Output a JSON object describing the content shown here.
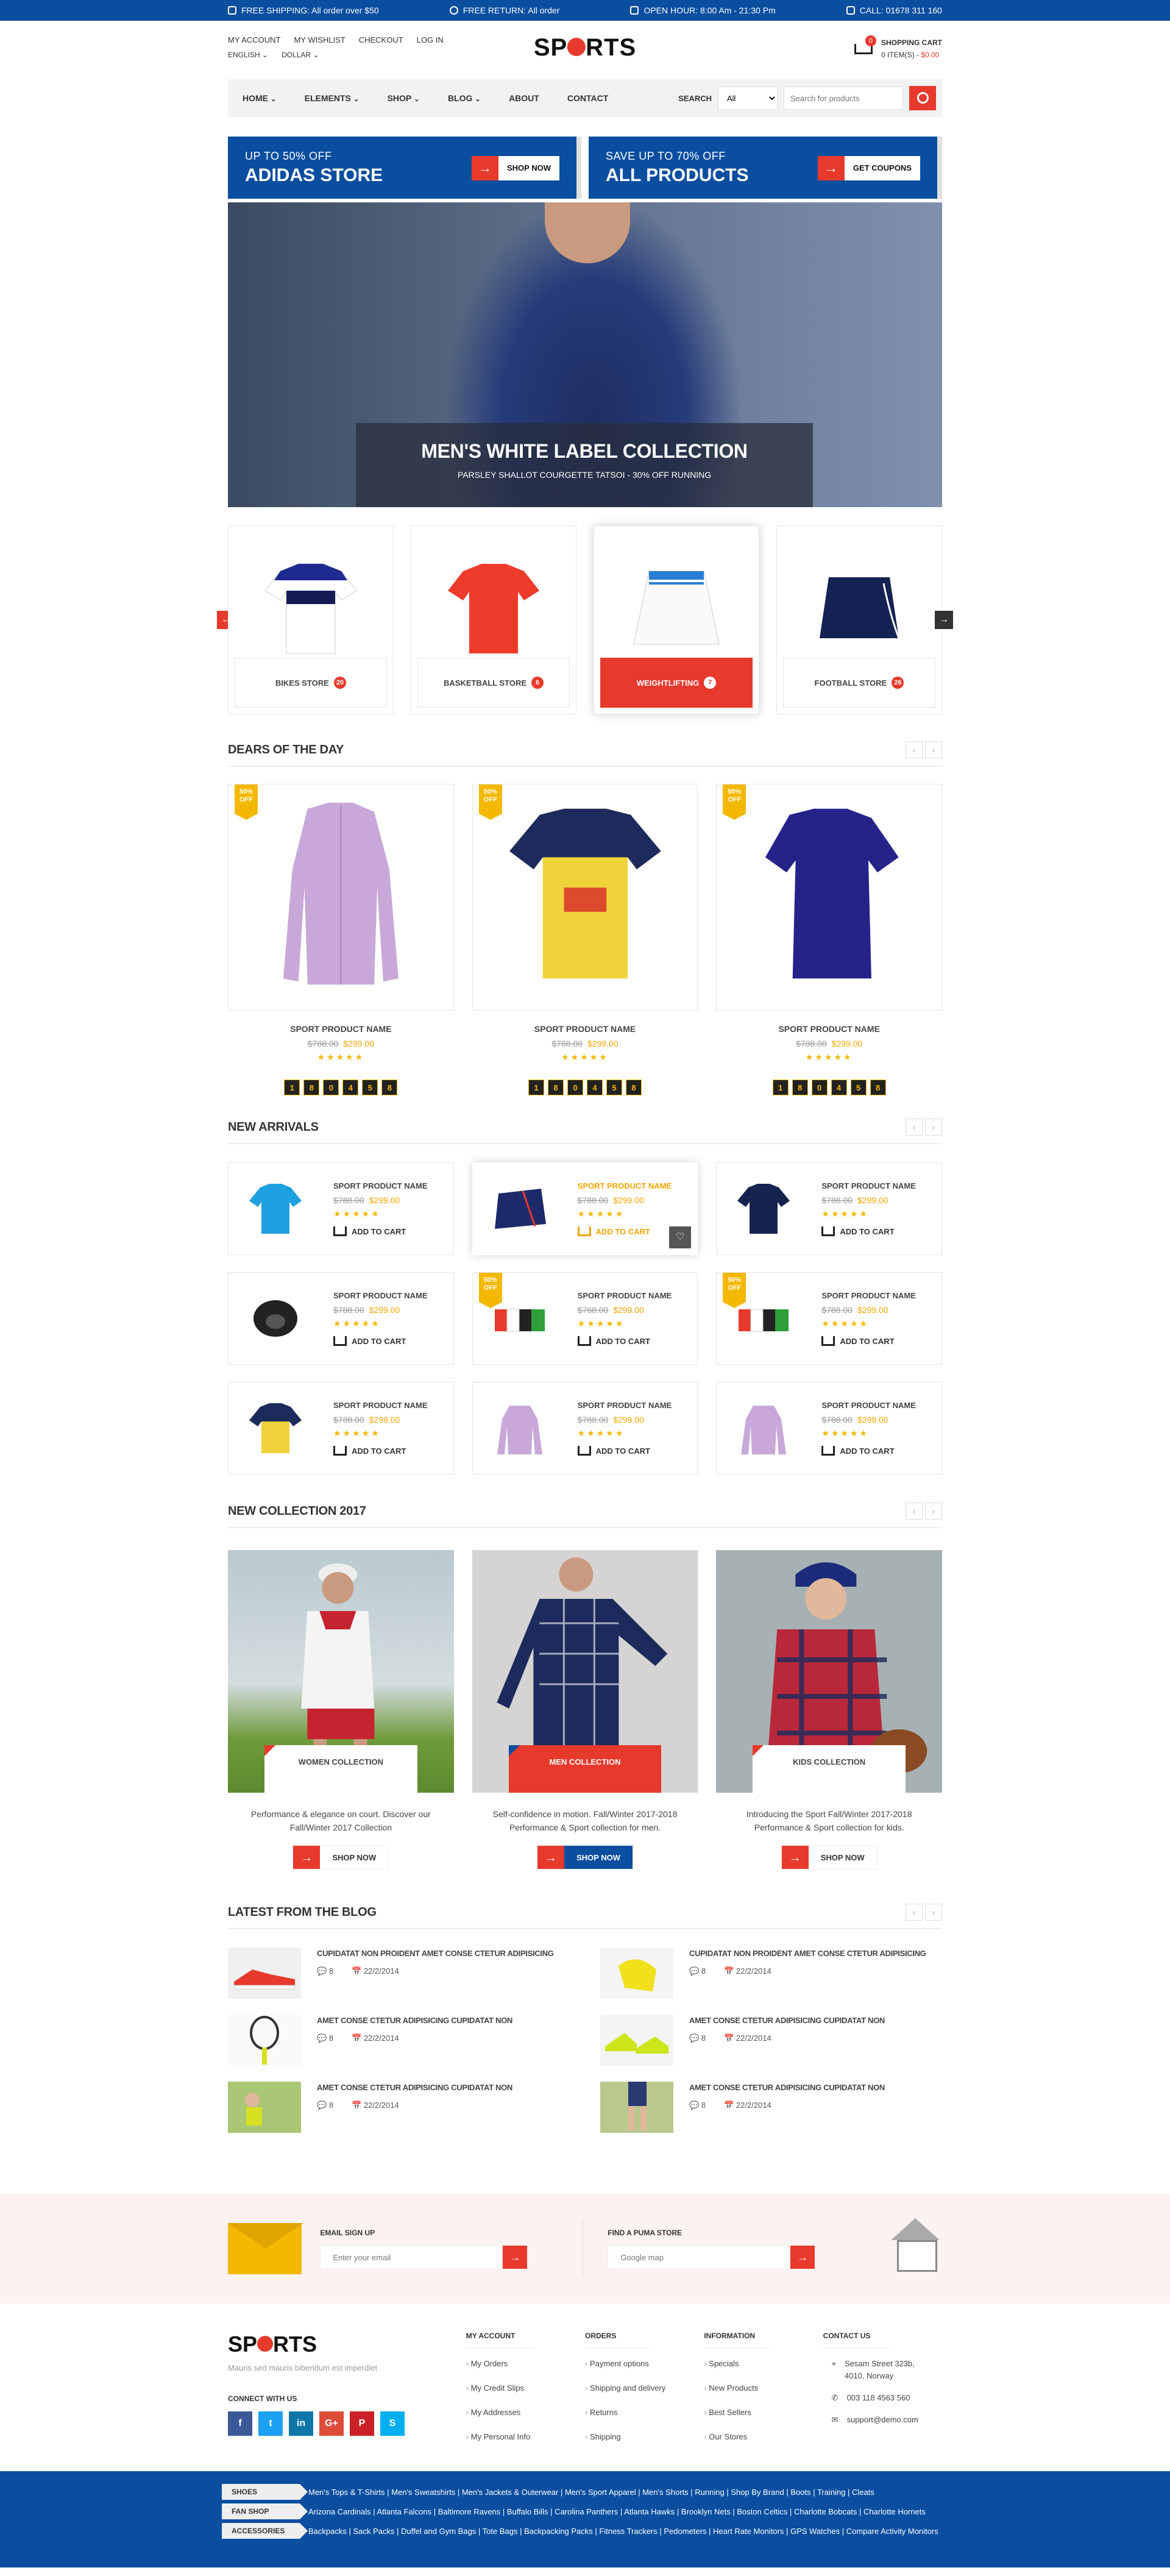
{
  "topbar": {
    "shipping": "FREE SHIPPING: All order over $50",
    "return": "FREE RETURN: All order",
    "hours": "OPEN HOUR: 8:00 Am - 21:30 Pm",
    "call": "CALL: 01678 311 160"
  },
  "header": {
    "account_links": [
      "MY ACCOUNT",
      "MY WISHLIST",
      "CHECKOUT",
      "LOG IN"
    ],
    "language": "ENGLISH",
    "currency": "DOLLAR",
    "logo": "SPORTS",
    "cart_label": "SHOPPING CART",
    "cart_items": "0 ITEM(S) -",
    "cart_total": "$0.00",
    "cart_count": "0"
  },
  "nav": {
    "items": [
      "HOME",
      "ELEMENTS",
      "SHOP",
      "BLOG",
      "ABOUT",
      "CONTACT"
    ],
    "search_label": "SEARCH",
    "category": "All",
    "search_placeholder": "Search for products"
  },
  "promos": [
    {
      "small": "UP TO 50% OFF",
      "big": "ADIDAS STORE",
      "btn": "SHOP NOW"
    },
    {
      "small": "SAVE UP TO 70% OFF",
      "big": "ALL PRODUCTS",
      "btn": "GET COUPONS"
    }
  ],
  "hero": {
    "title": "MEN'S WHITE LABEL COLLECTION",
    "subtitle": "PARSLEY SHALLOT COURGETTE TATSOI - 30% OFF RUNNING"
  },
  "categories": [
    {
      "label": "BIKES STORE",
      "count": "20"
    },
    {
      "label": "BASKETBALL STORE",
      "count": "6"
    },
    {
      "label": "WEIGHTLIFTING",
      "count": "7"
    },
    {
      "label": "FOOTBALL STORE",
      "count": "26"
    }
  ],
  "deals": {
    "title": "DEARS OF THE DAY",
    "items": [
      {
        "badge": "50% OFF",
        "name": "SPORT PRODUCT NAME",
        "old": "$788.00",
        "new": "$299.00",
        "timer": [
          "1",
          "8",
          "0",
          "4",
          "5",
          "8"
        ]
      },
      {
        "badge": "50% OFF",
        "name": "SPORT PRODUCT NAME",
        "old": "$788.00",
        "new": "$299.00",
        "timer": [
          "1",
          "8",
          "0",
          "4",
          "5",
          "8"
        ]
      },
      {
        "badge": "50% OFF",
        "name": "SPORT PRODUCT NAME",
        "old": "$788.00",
        "new": "$299.00",
        "timer": [
          "1",
          "8",
          "0",
          "4",
          "5",
          "8"
        ]
      }
    ]
  },
  "arrivals": {
    "title": "NEW ARRIVALS",
    "name": "SPORT PRODUCT NAME",
    "old": "$788.00",
    "new": "$299.00",
    "cart": "ADD TO CART",
    "badge": "50% OFF"
  },
  "collection": {
    "title": "NEW COLLECTION 2017",
    "items": [
      {
        "label": "WOMEN COLLECTION",
        "desc": "Performance & elegance on court. Discover our Fall/Winter 2017 Collection",
        "btn": "SHOP NOW"
      },
      {
        "label": "MEN COLLECTION",
        "desc": "Self-confidence in motion. Fall/Winter 2017-2018 Performance & Sport collection for men.",
        "btn": "SHOP NOW"
      },
      {
        "label": "KIDS COLLECTION",
        "desc": "Introducing the Sport Fall/Winter 2017-2018 Performance & Sport collection for kids.",
        "btn": "SHOP NOW"
      }
    ]
  },
  "blog": {
    "title": "LATEST FROM THE BLOG",
    "posts": [
      {
        "title": "CUPIDATAT NON PROIDENT AMET CONSE CTETUR ADIPISICING",
        "comments": "8",
        "date": "22/2/2014"
      },
      {
        "title": "CUPIDATAT NON PROIDENT AMET CONSE CTETUR ADIPISICING",
        "comments": "8",
        "date": "22/2/2014"
      },
      {
        "title": "AMET CONSE CTETUR ADIPISICING CUPIDATAT NON",
        "comments": "8",
        "date": "22/2/2014"
      },
      {
        "title": "AMET CONSE CTETUR ADIPISICING CUPIDATAT NON",
        "comments": "8",
        "date": "22/2/2014"
      },
      {
        "title": "AMET CONSE CTETUR ADIPISICING CUPIDATAT NON",
        "comments": "8",
        "date": "22/2/2014"
      },
      {
        "title": "AMET CONSE CTETUR ADIPISICING CUPIDATAT NON",
        "comments": "8",
        "date": "22/2/2014"
      }
    ]
  },
  "newsletter": {
    "email_label": "EMAIL SIGN UP",
    "email_placeholder": "Enter your email",
    "store_label": "FIND A PUMA STORE",
    "store_placeholder": "Google map"
  },
  "footer": {
    "logo": "SPORTS",
    "tagline": "Mauris sed mauris bibendum est imperdiet",
    "connect": "CONNECT WITH US",
    "account": {
      "title": "MY ACCOUNT",
      "links": [
        "My Orders",
        "My Credit Slips",
        "My Addresses",
        "My Personal Info"
      ]
    },
    "orders": {
      "title": "ORDERS",
      "links": [
        "Payment options",
        "Shipping and delivery",
        "Returns",
        "Shipping"
      ]
    },
    "information": {
      "title": "INFORMATION",
      "links": [
        "Specials",
        "New Products",
        "Best Sellers",
        "Our Stores"
      ]
    },
    "contact": {
      "title": "CONTACT US",
      "address": "Sesam Street 323b, 4010, Norway",
      "phone": "003 118 4563 560",
      "email": "support@demo.com"
    }
  },
  "bottom": [
    {
      "tag": "SHOES",
      "links": "Men's Tops & T-Shirts | Men's Sweatshirts | Men's Jackets & Outerwear | Men's Sport Apparel | Men's Shorts | Running | Shop By Brand | Boots | Training | Cleats"
    },
    {
      "tag": "FAN SHOP",
      "links": "Arizona Cardinals | Atlanta Falcons | Baltimore Ravens | Buffalo Bills | Carolina Panthers | Atlanta Hawks | Brooklyn Nets | Boston Celtics | Charlotte Bobcats | Charlotte Hornets"
    },
    {
      "tag": "ACCESSORIES",
      "links": "Backpacks | Sack Packs | Duffel and Gym Bags | Tote Bags | Backpacking Packs | Fitness Trackers | Pedometers | Heart Rate Monitors | GPS Watches | Compare Activity Monitors"
    }
  ],
  "colors": {
    "blue": "#0a4ea0",
    "red": "#e8392d",
    "yellow": "#f5b800"
  }
}
